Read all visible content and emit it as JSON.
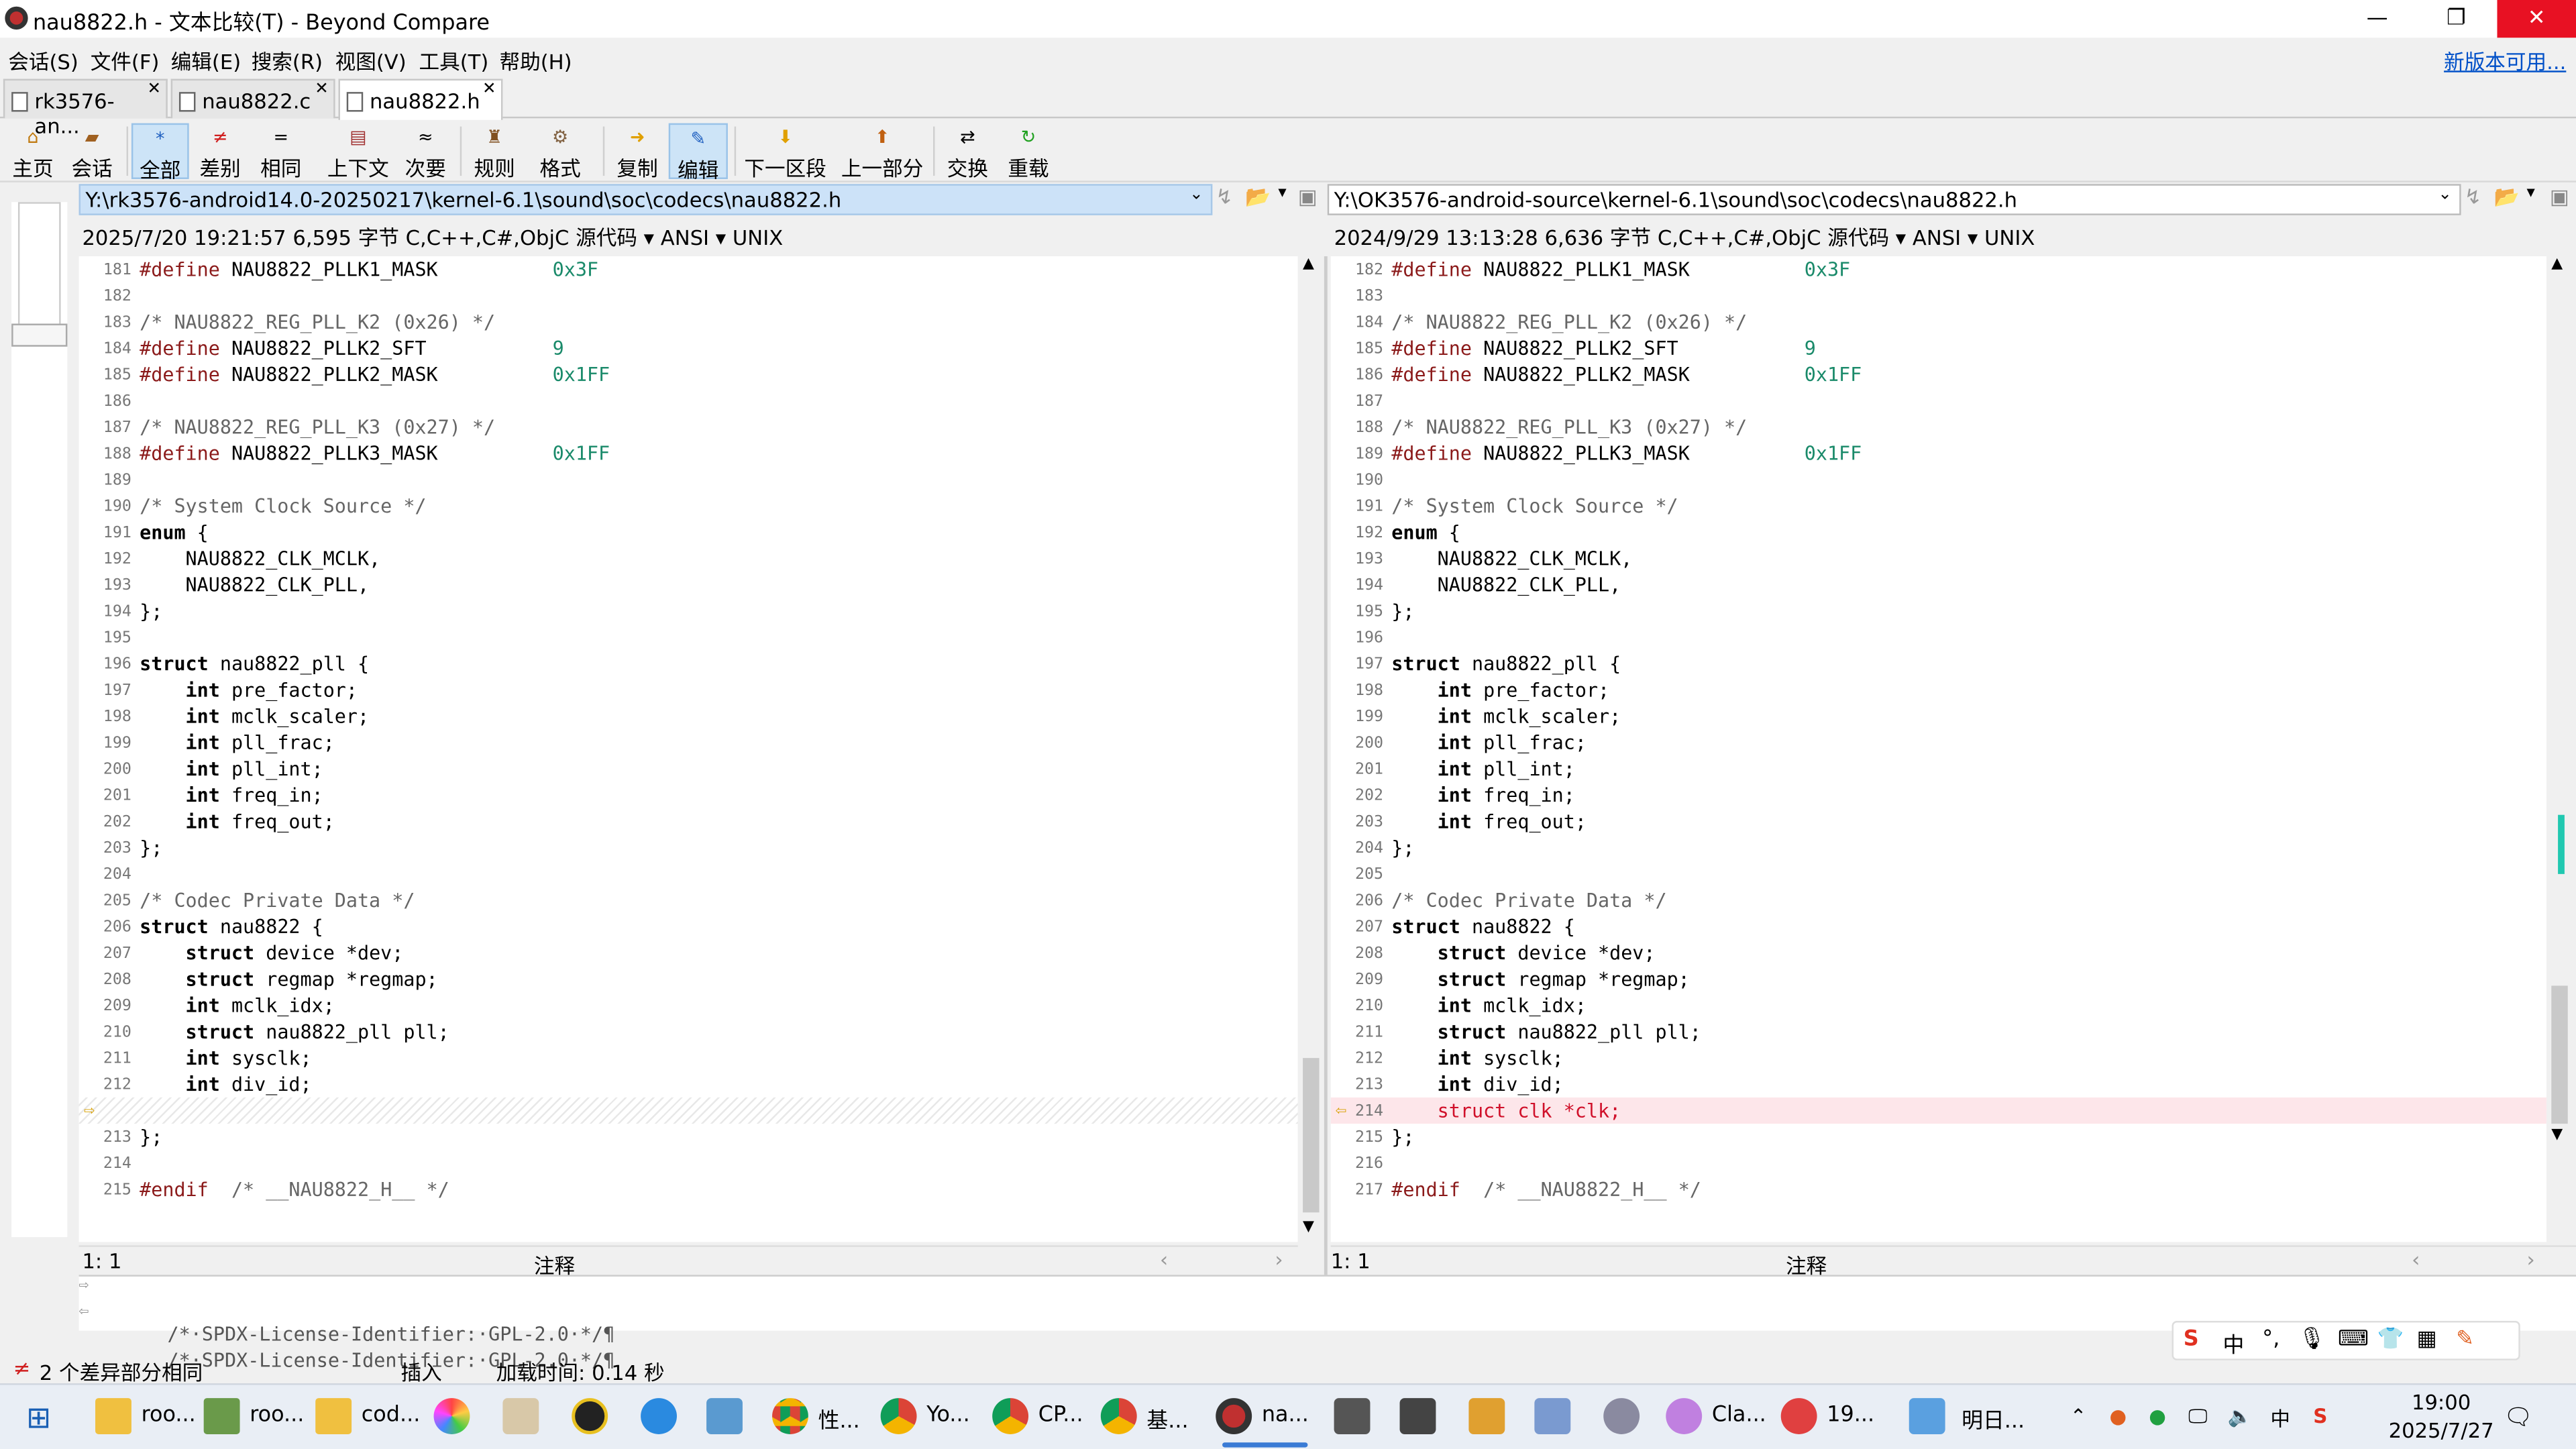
{
  "window": {
    "title": "nau8822.h - 文本比较(T) - Beyond Compare",
    "min": "—",
    "max": "❐",
    "close": "✕"
  },
  "menu": [
    "会话(S)",
    "文件(F)",
    "编辑(E)",
    "搜索(R)",
    "视图(V)",
    "工具(T)",
    "帮助(H)"
  ],
  "update_link": "新版本可用...",
  "tabs": [
    {
      "label": "rk3576-an..."
    },
    {
      "label": "nau8822.c"
    },
    {
      "label": "nau8822.h"
    }
  ],
  "toolbar": {
    "home": "主页",
    "session": "会话",
    "all": "全部",
    "diffs": "差别",
    "same": "相同",
    "context": "上下文",
    "minor": "次要",
    "rules": "规则",
    "format": "格式",
    "copy": "复制",
    "edit": "编辑",
    "next_section": "下一区段",
    "prev_section": "上一部分",
    "swap": "交换",
    "reload": "重载"
  },
  "left": {
    "path": "Y:\\rk3576-android14.0-20250217\\kernel-6.1\\sound\\soc\\codecs\\nau8822.h",
    "info": "2025/7/20 19:21:57  6,595 字节  C,C++,C#,ObjC 源代码 ▾ ANSI ▾ UNIX",
    "cursor": "1: 1",
    "mode": "注释",
    "lines": [
      {
        "n": "181",
        "t": "#define NAU8822_PLLK1_MASK          0x3F"
      },
      {
        "n": "182",
        "t": ""
      },
      {
        "n": "183",
        "t": "/* NAU8822_REG_PLL_K2 (0x26) */"
      },
      {
        "n": "184",
        "t": "#define NAU8822_PLLK2_SFT           9"
      },
      {
        "n": "185",
        "t": "#define NAU8822_PLLK2_MASK          0x1FF"
      },
      {
        "n": "186",
        "t": ""
      },
      {
        "n": "187",
        "t": "/* NAU8822_REG_PLL_K3 (0x27) */"
      },
      {
        "n": "188",
        "t": "#define NAU8822_PLLK3_MASK          0x1FF"
      },
      {
        "n": "189",
        "t": ""
      },
      {
        "n": "190",
        "t": "/* System Clock Source */"
      },
      {
        "n": "191",
        "t": "enum {"
      },
      {
        "n": "192",
        "t": "    NAU8822_CLK_MCLK,"
      },
      {
        "n": "193",
        "t": "    NAU8822_CLK_PLL,"
      },
      {
        "n": "194",
        "t": "};"
      },
      {
        "n": "195",
        "t": ""
      },
      {
        "n": "196",
        "t": "struct nau8822_pll {"
      },
      {
        "n": "197",
        "t": "    int pre_factor;"
      },
      {
        "n": "198",
        "t": "    int mclk_scaler;"
      },
      {
        "n": "199",
        "t": "    int pll_frac;"
      },
      {
        "n": "200",
        "t": "    int pll_int;"
      },
      {
        "n": "201",
        "t": "    int freq_in;"
      },
      {
        "n": "202",
        "t": "    int freq_out;"
      },
      {
        "n": "203",
        "t": "};"
      },
      {
        "n": "204",
        "t": ""
      },
      {
        "n": "205",
        "t": "/* Codec Private Data */"
      },
      {
        "n": "206",
        "t": "struct nau8822 {"
      },
      {
        "n": "207",
        "t": "    struct device *dev;"
      },
      {
        "n": "208",
        "t": "    struct regmap *regmap;"
      },
      {
        "n": "209",
        "t": "    int mclk_idx;"
      },
      {
        "n": "210",
        "t": "    struct nau8822_pll pll;"
      },
      {
        "n": "211",
        "t": "    int sysclk;"
      },
      {
        "n": "212",
        "t": "    int div_id;"
      },
      {
        "n": "",
        "t": ""
      },
      {
        "n": "213",
        "t": "};"
      },
      {
        "n": "214",
        "t": ""
      },
      {
        "n": "215",
        "t": "#endif  /* __NAU8822_H__ */"
      }
    ]
  },
  "right": {
    "path": "Y:\\OK3576-android-source\\kernel-6.1\\sound\\soc\\codecs\\nau8822.h",
    "info": "2024/9/29 13:13:28  6,636 字节  C,C++,C#,ObjC 源代码 ▾ ANSI ▾ UNIX",
    "cursor": "1: 1",
    "mode": "注释",
    "lines": [
      {
        "n": "182",
        "t": "#define NAU8822_PLLK1_MASK          0x3F"
      },
      {
        "n": "183",
        "t": ""
      },
      {
        "n": "184",
        "t": "/* NAU8822_REG_PLL_K2 (0x26) */"
      },
      {
        "n": "185",
        "t": "#define NAU8822_PLLK2_SFT           9"
      },
      {
        "n": "186",
        "t": "#define NAU8822_PLLK2_MASK          0x1FF"
      },
      {
        "n": "187",
        "t": ""
      },
      {
        "n": "188",
        "t": "/* NAU8822_REG_PLL_K3 (0x27) */"
      },
      {
        "n": "189",
        "t": "#define NAU8822_PLLK3_MASK          0x1FF"
      },
      {
        "n": "190",
        "t": ""
      },
      {
        "n": "191",
        "t": "/* System Clock Source */"
      },
      {
        "n": "192",
        "t": "enum {"
      },
      {
        "n": "193",
        "t": "    NAU8822_CLK_MCLK,"
      },
      {
        "n": "194",
        "t": "    NAU8822_CLK_PLL,"
      },
      {
        "n": "195",
        "t": "};"
      },
      {
        "n": "196",
        "t": ""
      },
      {
        "n": "197",
        "t": "struct nau8822_pll {"
      },
      {
        "n": "198",
        "t": "    int pre_factor;"
      },
      {
        "n": "199",
        "t": "    int mclk_scaler;"
      },
      {
        "n": "200",
        "t": "    int pll_frac;"
      },
      {
        "n": "201",
        "t": "    int pll_int;"
      },
      {
        "n": "202",
        "t": "    int freq_in;"
      },
      {
        "n": "203",
        "t": "    int freq_out;"
      },
      {
        "n": "204",
        "t": "};"
      },
      {
        "n": "205",
        "t": ""
      },
      {
        "n": "206",
        "t": "/* Codec Private Data */"
      },
      {
        "n": "207",
        "t": "struct nau8822 {"
      },
      {
        "n": "208",
        "t": "    struct device *dev;"
      },
      {
        "n": "209",
        "t": "    struct regmap *regmap;"
      },
      {
        "n": "210",
        "t": "    int mclk_idx;"
      },
      {
        "n": "211",
        "t": "    struct nau8822_pll pll;"
      },
      {
        "n": "212",
        "t": "    int sysclk;"
      },
      {
        "n": "213",
        "t": "    int div_id;"
      },
      {
        "n": "214",
        "t": "    struct clk *clk;"
      },
      {
        "n": "215",
        "t": "};"
      },
      {
        "n": "216",
        "t": ""
      },
      {
        "n": "217",
        "t": "#endif  /* __NAU8822_H__ */"
      }
    ]
  },
  "line_compare": [
    "/*·SPDX-License-Identifier:·GPL-2.0·*/¶",
    "/*·SPDX-License-Identifier:·GPL-2.0·*/¶"
  ],
  "status": {
    "diffs": "2 个差异部分相同",
    "insert": "插入",
    "load_time": "加载时间: 0.14 秒"
  },
  "taskbar": {
    "items": [
      "roo...",
      "roo...",
      "cod...",
      "性...",
      "Yo...",
      "CP...",
      "基...",
      "na...",
      "Cla...",
      "19...",
      "明日..."
    ],
    "time": "19:00",
    "date": "2025/7/27"
  },
  "ime": {
    "lang": "中"
  }
}
